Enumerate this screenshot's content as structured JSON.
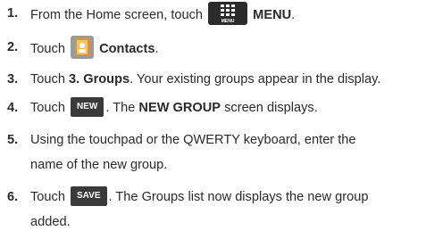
{
  "steps": [
    {
      "number": "1.",
      "before": "From the Home screen, touch",
      "icon": "menu-icon",
      "icon_caption": "MENU",
      "bold": "MENU",
      "after": "."
    },
    {
      "number": "2.",
      "before": "Touch",
      "icon": "contacts-icon",
      "bold": "Contacts",
      "after": "."
    },
    {
      "number": "3.",
      "before": "Touch",
      "bold": "3. Groups",
      "after": ". Your existing groups appear in the display."
    },
    {
      "number": "4.",
      "before": "Touch",
      "button_label": "NEW",
      "middle": ". The",
      "bold": "NEW GROUP",
      "after": "screen displays."
    },
    {
      "number": "5.",
      "line1": "Using the touchpad or the QWERTY keyboard, enter the",
      "line2": "name of the new group."
    },
    {
      "number": "6.",
      "before": "Touch",
      "button_label": "SAVE",
      "after": ". The Groups list now displays the new group",
      "line2": "added."
    }
  ],
  "colors": {
    "text": "#2a2a2a",
    "icon_background": "#2b2b2b",
    "button_background": "#3a3a3a",
    "contacts_icon_background": "#9a9a9a",
    "contacts_icon_foreground": "#e8902a"
  }
}
